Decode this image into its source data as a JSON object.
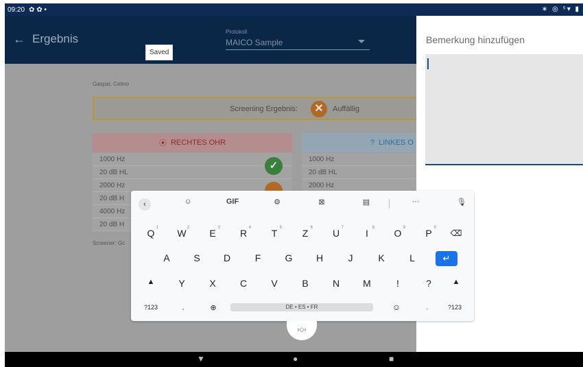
{
  "status_bar": {
    "time": "09:20",
    "left_icons": "✿ ✿ •",
    "right_icons": "∗ ◎ ⁵▾ ▮"
  },
  "app_bar": {
    "back_icon": "arrow-left-icon",
    "title": "Ergebnis",
    "protocol_label": "Protokoll",
    "protocol_value": "MAICO Sample"
  },
  "toast": {
    "text": "Saved"
  },
  "content": {
    "patient_name": "Gaspar, Celino",
    "screening_label": "Screening Ergebnis:",
    "screening_value": "Auffällig",
    "right_ear": {
      "title": "RECHTES OHR",
      "rows": [
        "1000 Hz",
        "20 dB HL",
        "2000 Hz",
        "20 dB H",
        "4000 Hz",
        "20 dB H"
      ]
    },
    "left_ear": {
      "title": "LINKES O",
      "rows": [
        "1000 Hz",
        "20 dB HL",
        "2000 Hz"
      ]
    },
    "screener_label": "Screener: Gc"
  },
  "dialog": {
    "title": "Bemerkung hinzufügen",
    "input_value": ""
  },
  "keyboard": {
    "tools": {
      "gif": "GIF",
      "more": "···"
    },
    "row1": [
      "Q",
      "W",
      "E",
      "R",
      "T",
      "Z",
      "U",
      "I",
      "O",
      "P"
    ],
    "row1_hints": [
      "1",
      "2",
      "3",
      "4",
      "5",
      "6",
      "7",
      "8",
      "9",
      "0"
    ],
    "row2": [
      "A",
      "S",
      "D",
      "F",
      "G",
      "H",
      "J",
      "K",
      "L"
    ],
    "row3": [
      "Y",
      "X",
      "C",
      "V",
      "B",
      "N",
      "M",
      "!",
      "?"
    ],
    "symbols_key": "?123",
    "comma_key": ",",
    "period_key": ".",
    "space_label": "DE • ES • FR",
    "symbols_key_right": "?123"
  },
  "colors": {
    "app_bar": "#0b2747",
    "enter_key": "#1a73e8",
    "dialog_underline": "#1e4b7a"
  }
}
